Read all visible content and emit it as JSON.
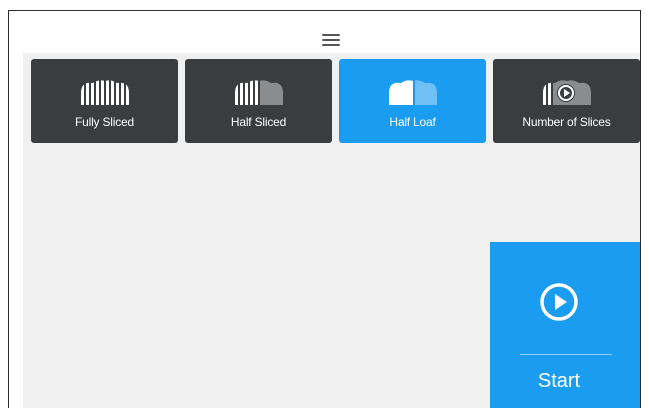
{
  "menu": {
    "icon": "hamburger-menu-icon"
  },
  "tiles": [
    {
      "label": "Fully Sliced",
      "icon": "fully-sliced-bread-icon",
      "active": false
    },
    {
      "label": "Half Sliced",
      "icon": "half-sliced-bread-icon",
      "active": false
    },
    {
      "label": "Half Loaf",
      "icon": "half-loaf-icon",
      "active": true
    },
    {
      "label": "Number of Slices",
      "icon": "number-of-slices-icon",
      "active": false
    }
  ],
  "start": {
    "label": "Start",
    "icon": "play-circle-icon"
  },
  "colors": {
    "accent": "#1a9cf0",
    "tile_dark": "#3a3c3e",
    "background": "#f0f0f0"
  }
}
